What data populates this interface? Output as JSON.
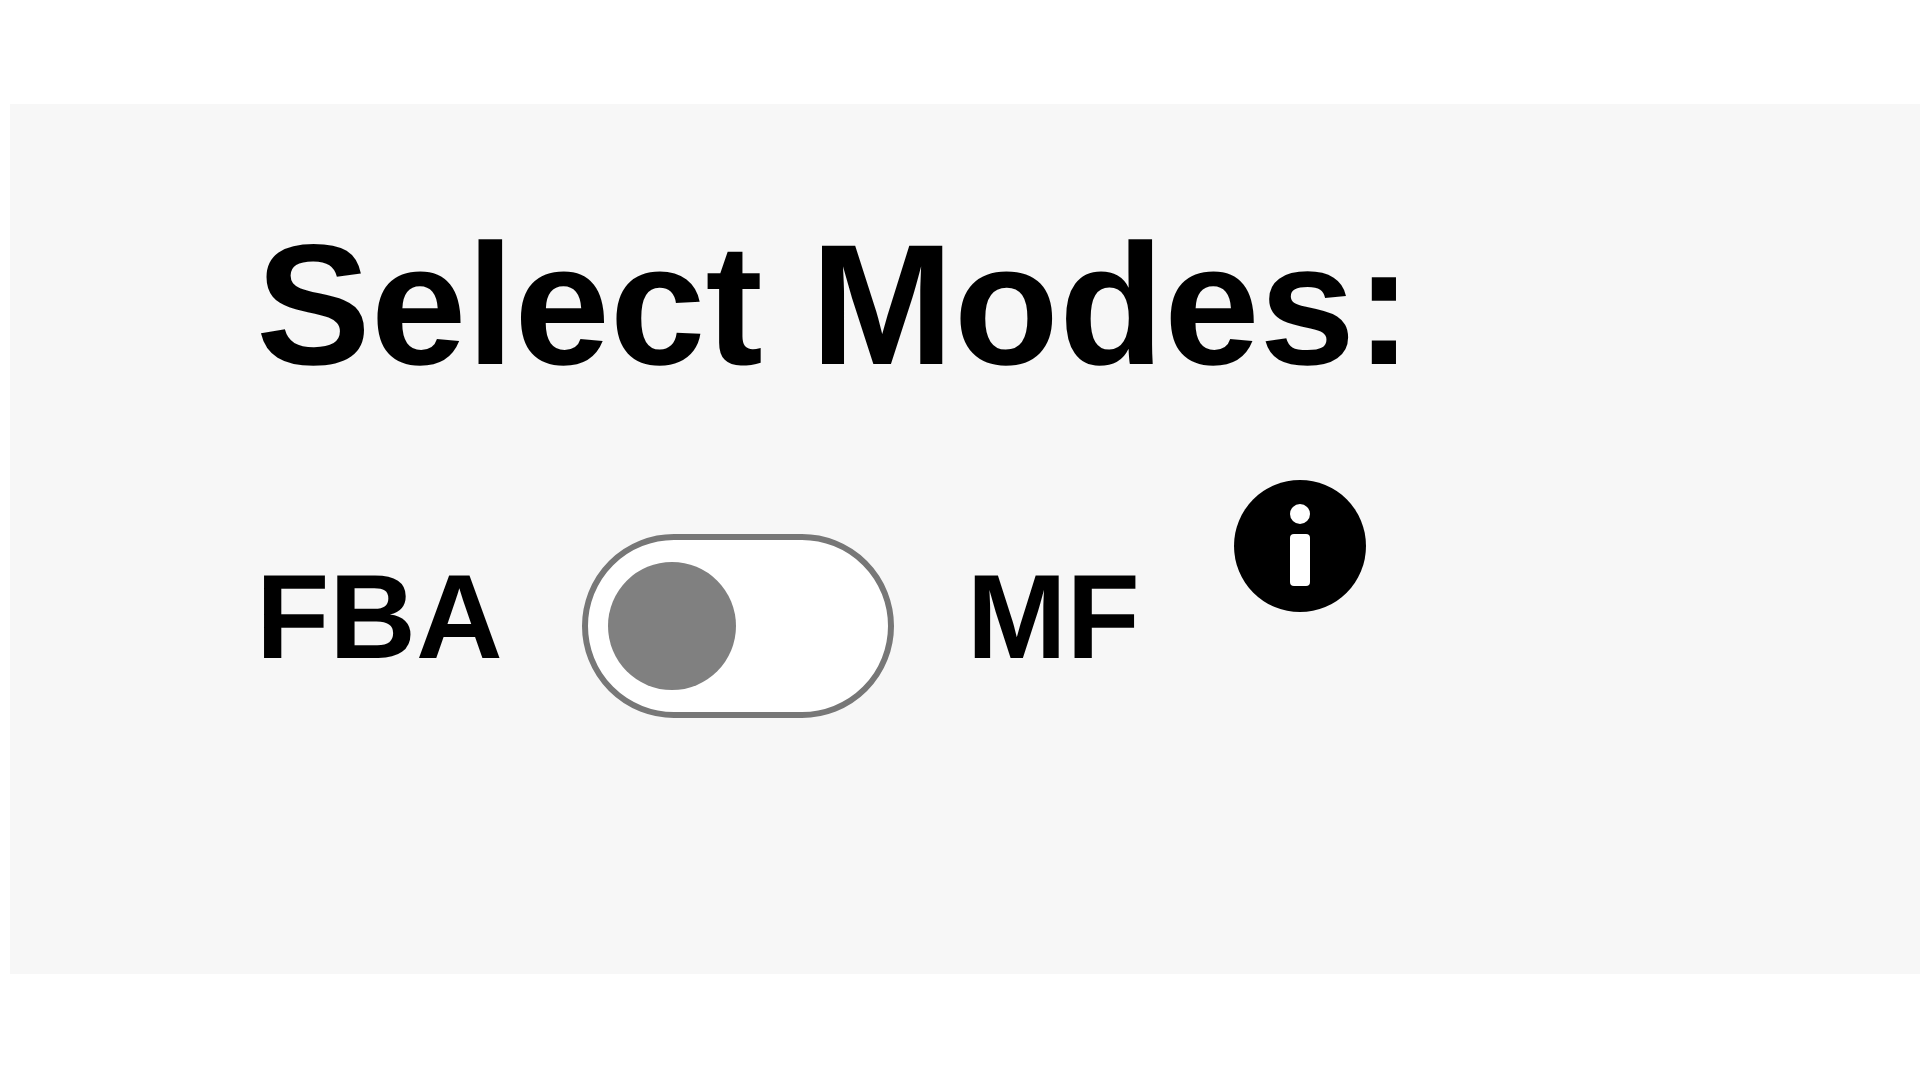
{
  "title": "Select Modes:",
  "mode_toggle": {
    "left_label": "FBA",
    "right_label": "MF",
    "on": false
  }
}
